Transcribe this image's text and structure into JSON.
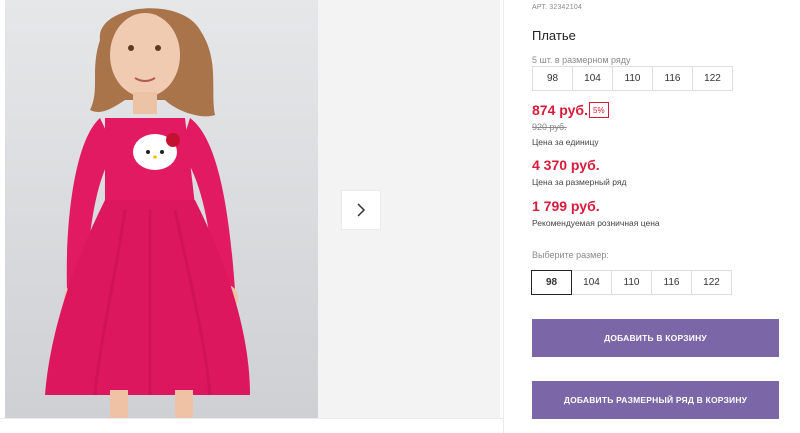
{
  "product": {
    "article_label": "АРТ.",
    "article_value": "32342104",
    "title": "Платье",
    "pack_note": "5 шт. в размерном ряду",
    "pack_sizes": [
      "98",
      "104",
      "110",
      "116",
      "122"
    ],
    "unit_price": "874 руб.",
    "discount": "5%",
    "old_price": "920 руб.",
    "unit_price_caption": "Цена за единицу",
    "pack_price": "4 370 руб.",
    "pack_price_caption": "Цена за размерный ряд",
    "retail_price": "1 799 руб.",
    "retail_price_caption": "Рекомендуемая розничная цена"
  },
  "size_picker": {
    "label": "Выберите размер:",
    "options": [
      "98",
      "104",
      "110",
      "116",
      "122"
    ],
    "selected": "98"
  },
  "actions": {
    "add_to_cart": "ДОБАВИТЬ В КОРЗИНУ",
    "add_pack_to_cart": "ДОБАВИТЬ РАЗМЕРНЫЙ РЯД В КОРЗИНУ"
  },
  "colors": {
    "price_red": "#d81b3a",
    "button_purple": "#7b66a8",
    "dress_pink": "#e21a62"
  },
  "icons": {
    "next": "chevron-right-icon"
  }
}
